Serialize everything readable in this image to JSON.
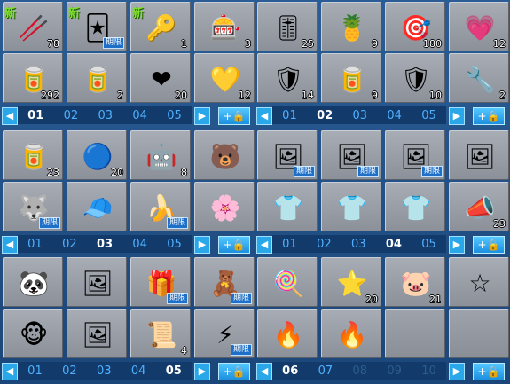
{
  "labels": {
    "limited": "期限",
    "new": "新"
  },
  "icons": {
    "left": "◀",
    "right": "▶",
    "add": "+🔒"
  },
  "panels": [
    {
      "pages": [
        {
          "label": "01",
          "state": "cur"
        },
        {
          "label": "02",
          "state": ""
        },
        {
          "label": "03",
          "state": ""
        },
        {
          "label": "04",
          "state": ""
        },
        {
          "label": "05",
          "state": ""
        }
      ],
      "slots": [
        {
          "icon": "🥢",
          "name": "blue-wand-icon",
          "qty": "78",
          "new": true,
          "limited": false
        },
        {
          "icon": "🃏",
          "name": "card-icon",
          "qty": "",
          "new": true,
          "limited": true
        },
        {
          "icon": "🔑",
          "name": "key-icon",
          "qty": "1",
          "new": true,
          "limited": false
        },
        {
          "icon": "🎰",
          "name": "machine-icon",
          "qty": "3",
          "new": false,
          "limited": false
        },
        {
          "icon": "🥫",
          "name": "blue-can-icon",
          "qty": "292",
          "new": false,
          "limited": false
        },
        {
          "icon": "🥫",
          "name": "red-can-icon",
          "qty": "2",
          "new": false,
          "limited": false
        },
        {
          "icon": "❤",
          "name": "heart-wand-icon",
          "qty": "20",
          "new": false,
          "limited": false
        },
        {
          "icon": "💛",
          "name": "heart-badge-icon",
          "qty": "12",
          "new": false,
          "limited": false
        }
      ]
    },
    {
      "pages": [
        {
          "label": "01",
          "state": ""
        },
        {
          "label": "02",
          "state": "cur"
        },
        {
          "label": "03",
          "state": ""
        },
        {
          "label": "04",
          "state": ""
        },
        {
          "label": "05",
          "state": ""
        }
      ],
      "slots": [
        {
          "icon": "🎚",
          "name": "toolbox-icon",
          "qty": "25",
          "new": false,
          "limited": false
        },
        {
          "icon": "🍍",
          "name": "pineapple-icon",
          "qty": "9",
          "new": false,
          "limited": false
        },
        {
          "icon": "🎯",
          "name": "dart-icon",
          "qty": "180",
          "new": false,
          "limited": false
        },
        {
          "icon": "💗",
          "name": "pink-badge-icon",
          "qty": "12",
          "new": false,
          "limited": false
        },
        {
          "icon": "🛡",
          "name": "red-shield-icon",
          "qty": "14",
          "new": false,
          "limited": false
        },
        {
          "icon": "🥫",
          "name": "green-can-icon",
          "qty": "9",
          "new": false,
          "limited": false
        },
        {
          "icon": "🛡",
          "name": "green-shield-icon",
          "qty": "10",
          "new": false,
          "limited": false
        },
        {
          "icon": "🔧",
          "name": "red-tool-icon",
          "qty": "2",
          "new": false,
          "limited": false
        }
      ]
    },
    {
      "pages": [
        {
          "label": "01",
          "state": ""
        },
        {
          "label": "02",
          "state": ""
        },
        {
          "label": "03",
          "state": "cur"
        },
        {
          "label": "04",
          "state": ""
        },
        {
          "label": "05",
          "state": ""
        }
      ],
      "slots": [
        {
          "icon": "🥫",
          "name": "green-can-icon",
          "qty": "23",
          "new": false,
          "limited": false
        },
        {
          "icon": "🔵",
          "name": "blue-ring-icon",
          "qty": "20",
          "new": false,
          "limited": false
        },
        {
          "icon": "🤖",
          "name": "robot-icon",
          "qty": "8",
          "new": false,
          "limited": false
        },
        {
          "icon": "🐻",
          "name": "bear-head-icon",
          "qty": "",
          "new": false,
          "limited": false
        },
        {
          "icon": "🐺",
          "name": "black-creature-icon",
          "qty": "",
          "new": false,
          "limited": true
        },
        {
          "icon": "🧢",
          "name": "red-hat-icon",
          "qty": "",
          "new": false,
          "limited": false
        },
        {
          "icon": "🍌",
          "name": "banana-icon",
          "qty": "",
          "new": false,
          "limited": true
        },
        {
          "icon": "🌸",
          "name": "flower-icon",
          "qty": "",
          "new": false,
          "limited": false
        }
      ]
    },
    {
      "pages": [
        {
          "label": "01",
          "state": ""
        },
        {
          "label": "02",
          "state": ""
        },
        {
          "label": "03",
          "state": ""
        },
        {
          "label": "04",
          "state": "cur"
        },
        {
          "label": "05",
          "state": ""
        }
      ],
      "slots": [
        {
          "icon": "🖼",
          "name": "frame-icon",
          "qty": "",
          "new": false,
          "limited": true
        },
        {
          "icon": "🖼",
          "name": "frame-icon",
          "qty": "",
          "new": false,
          "limited": true
        },
        {
          "icon": "🖼",
          "name": "frame-icon",
          "qty": "",
          "new": false,
          "limited": true
        },
        {
          "icon": "🖼",
          "name": "frame-icon",
          "qty": "",
          "new": false,
          "limited": false
        },
        {
          "icon": "👕",
          "name": "red-shirt-icon",
          "qty": "",
          "new": false,
          "limited": false
        },
        {
          "icon": "👕",
          "name": "red-shirt-icon",
          "qty": "",
          "new": false,
          "limited": false
        },
        {
          "icon": "👕",
          "name": "red-shirt-icon",
          "qty": "",
          "new": false,
          "limited": false
        },
        {
          "icon": "📣",
          "name": "megaphone-icon",
          "qty": "23",
          "new": false,
          "limited": false
        }
      ]
    },
    {
      "pages": [
        {
          "label": "01",
          "state": ""
        },
        {
          "label": "02",
          "state": ""
        },
        {
          "label": "03",
          "state": ""
        },
        {
          "label": "04",
          "state": ""
        },
        {
          "label": "05",
          "state": "cur"
        }
      ],
      "slots": [
        {
          "icon": "🐼",
          "name": "panda-icon",
          "qty": "",
          "new": false,
          "limited": false
        },
        {
          "icon": "🖼",
          "name": "frame-icon",
          "qty": "",
          "new": false,
          "limited": false
        },
        {
          "icon": "🎁",
          "name": "present-icon",
          "qty": "",
          "new": false,
          "limited": true
        },
        {
          "icon": "🧸",
          "name": "teddy-icon",
          "qty": "",
          "new": false,
          "limited": true
        },
        {
          "icon": "🐵",
          "name": "blue-monkey-icon",
          "qty": "",
          "new": false,
          "limited": false
        },
        {
          "icon": "🖼",
          "name": "frame-icon",
          "qty": "",
          "new": false,
          "limited": false
        },
        {
          "icon": "📜",
          "name": "tablet-icon",
          "qty": "4",
          "new": false,
          "limited": false
        },
        {
          "icon": "⚡",
          "name": "lightning-icon",
          "qty": "",
          "new": false,
          "limited": true
        }
      ]
    },
    {
      "pages": [
        {
          "label": "06",
          "state": "cur"
        },
        {
          "label": "07",
          "state": ""
        },
        {
          "label": "08",
          "state": "dim"
        },
        {
          "label": "09",
          "state": "dim"
        },
        {
          "label": "10",
          "state": "dim"
        }
      ],
      "slots": [
        {
          "icon": "🍭",
          "name": "candy-cane-icon",
          "qty": "",
          "new": false,
          "limited": false
        },
        {
          "icon": "⭐",
          "name": "red-star-icon",
          "qty": "20",
          "new": false,
          "limited": false
        },
        {
          "icon": "🐷",
          "name": "pig-box-icon",
          "qty": "21",
          "new": false,
          "limited": false
        },
        {
          "icon": "☆",
          "name": "blue-star-icon",
          "qty": "",
          "new": false,
          "limited": false
        },
        {
          "icon": "🔥",
          "name": "blue-flame-icon",
          "qty": "",
          "new": false,
          "limited": false
        },
        {
          "icon": "🔥",
          "name": "grey-flame-icon",
          "qty": "",
          "new": false,
          "limited": false
        },
        {
          "icon": "",
          "name": "empty-slot",
          "qty": "",
          "new": false,
          "limited": false
        },
        {
          "icon": "",
          "name": "empty-slot",
          "qty": "",
          "new": false,
          "limited": false
        }
      ]
    }
  ]
}
